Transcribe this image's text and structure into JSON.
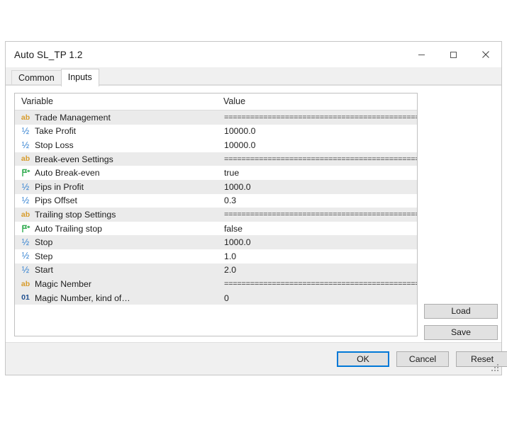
{
  "window": {
    "title": "Auto SL_TP 1.2",
    "controls": [
      {
        "name": "minimize",
        "label": "—"
      },
      {
        "name": "maximize",
        "label": "□"
      },
      {
        "name": "close",
        "label": "✕"
      }
    ]
  },
  "tabs": [
    {
      "label": "Common",
      "active": false
    },
    {
      "label": "Inputs",
      "active": true
    }
  ],
  "grid": {
    "headers": {
      "variable": "Variable",
      "value": "Value"
    },
    "separator": "==================================================",
    "rows": [
      {
        "icon": "ab",
        "name": "Trade Management",
        "value": "==================================================",
        "sep": true,
        "alt": true
      },
      {
        "icon": "half",
        "name": "Take Profit",
        "value": "10000.0",
        "sep": false,
        "alt": false
      },
      {
        "icon": "half",
        "name": "Stop Loss",
        "value": "10000.0",
        "sep": false,
        "alt": false
      },
      {
        "icon": "ab",
        "name": "Break-even Settings",
        "value": "==================================================",
        "sep": true,
        "alt": true
      },
      {
        "icon": "flag",
        "name": "Auto Break-even",
        "value": "true",
        "sep": false,
        "alt": false
      },
      {
        "icon": "half",
        "name": "Pips in Profit",
        "value": "1000.0",
        "sep": false,
        "alt": true
      },
      {
        "icon": "half",
        "name": "Pips Offset",
        "value": "0.3",
        "sep": false,
        "alt": false
      },
      {
        "icon": "ab",
        "name": "Trailing stop Settings",
        "value": "==================================================",
        "sep": true,
        "alt": true
      },
      {
        "icon": "flag",
        "name": "Auto Trailing stop",
        "value": "false",
        "sep": false,
        "alt": false
      },
      {
        "icon": "half",
        "name": "Stop",
        "value": "1000.0",
        "sep": false,
        "alt": true
      },
      {
        "icon": "half",
        "name": "Step",
        "value": "1.0",
        "sep": false,
        "alt": false
      },
      {
        "icon": "half",
        "name": "Start",
        "value": "2.0",
        "sep": false,
        "alt": true
      },
      {
        "icon": "ab",
        "name": "Magic Nember",
        "value": "==================================================",
        "sep": true,
        "alt": true
      },
      {
        "icon": "int",
        "name": "Magic Number, kind of…",
        "value": "0",
        "sep": false,
        "alt": true
      }
    ]
  },
  "side_buttons": {
    "load": "Load",
    "save": "Save"
  },
  "footer_buttons": {
    "ok": "OK",
    "cancel": "Cancel",
    "reset": "Reset"
  },
  "colors": {
    "accent": "#0078d7",
    "icon_string": "#d79b2b",
    "icon_double": "#2f7fd0",
    "icon_bool": "#2faa4e",
    "icon_int": "#1f4f8f"
  }
}
